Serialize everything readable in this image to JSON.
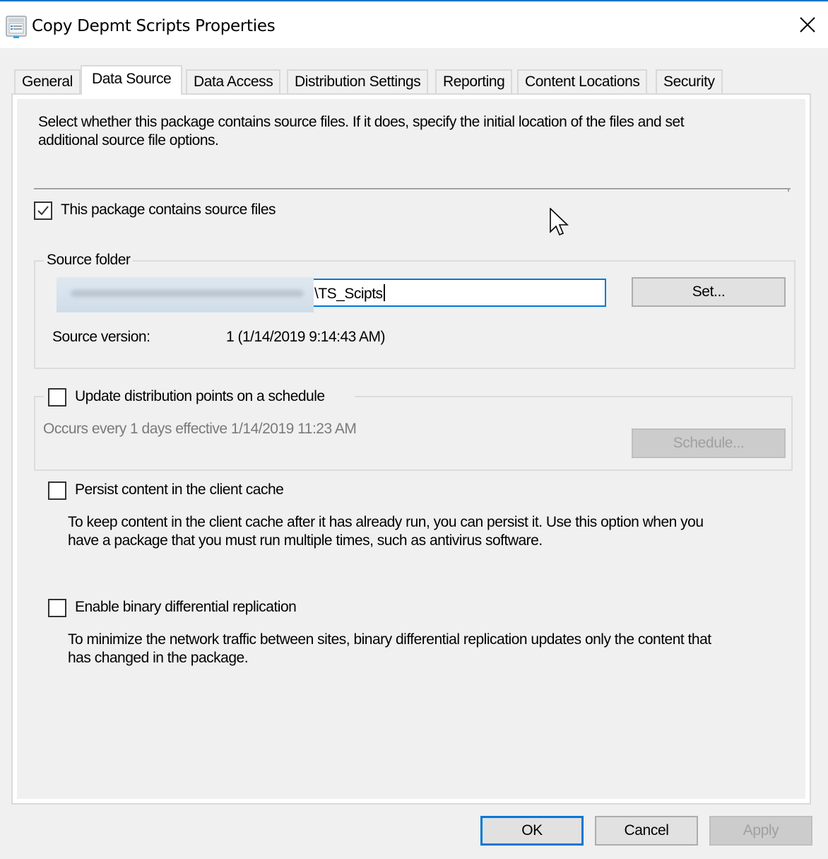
{
  "window": {
    "title": "Copy Depmt Scripts Properties",
    "icon": "properties-sheet-icon",
    "close_icon": "close-icon"
  },
  "tabs": [
    {
      "label": "General",
      "active": false
    },
    {
      "label": "Data Source",
      "active": true
    },
    {
      "label": "Data Access",
      "active": false
    },
    {
      "label": "Distribution Settings",
      "active": false
    },
    {
      "label": "Reporting",
      "active": false
    },
    {
      "label": "Content Locations",
      "active": false
    },
    {
      "label": "Security",
      "active": false
    }
  ],
  "data_source": {
    "intro_line1": "Select whether this package contains source files. If it does, specify the initial location of the files and set",
    "intro_line2": "additional source file options.",
    "contains_source_files": {
      "label": "This package contains source files",
      "checked": true
    },
    "source_folder": {
      "legend": "Source folder",
      "path_visible_suffix": "\\TS_Scipts",
      "path_obscured": true,
      "set_button": "Set...",
      "version_label": "Source version:",
      "version_value": "1 (1/14/2019 9:14:43 AM)"
    },
    "schedule": {
      "label": "Update distribution points on a schedule",
      "checked": false,
      "description": "Occurs every 1 days effective 1/14/2019 11:23 AM",
      "schedule_button": "Schedule...",
      "schedule_button_enabled": false
    },
    "persist": {
      "label": "Persist content in the client cache",
      "checked": false,
      "description_line1": "To keep content in the client cache after it has already run, you can persist it. Use this option when you",
      "description_line2": "have  a package that you must run multiple times, such as antivirus software."
    },
    "binary_diff": {
      "label": "Enable binary differential replication",
      "checked": false,
      "description_line1": "To minimize the network traffic between sites, binary differential replication updates only the content that",
      "description_line2": "has changed in the package."
    }
  },
  "footer": {
    "ok": "OK",
    "cancel": "Cancel",
    "apply": "Apply",
    "apply_enabled": false
  },
  "colors": {
    "accent": "#0078d7",
    "background": "#f0f0f0",
    "disabled_text": "#a0a0a0"
  }
}
